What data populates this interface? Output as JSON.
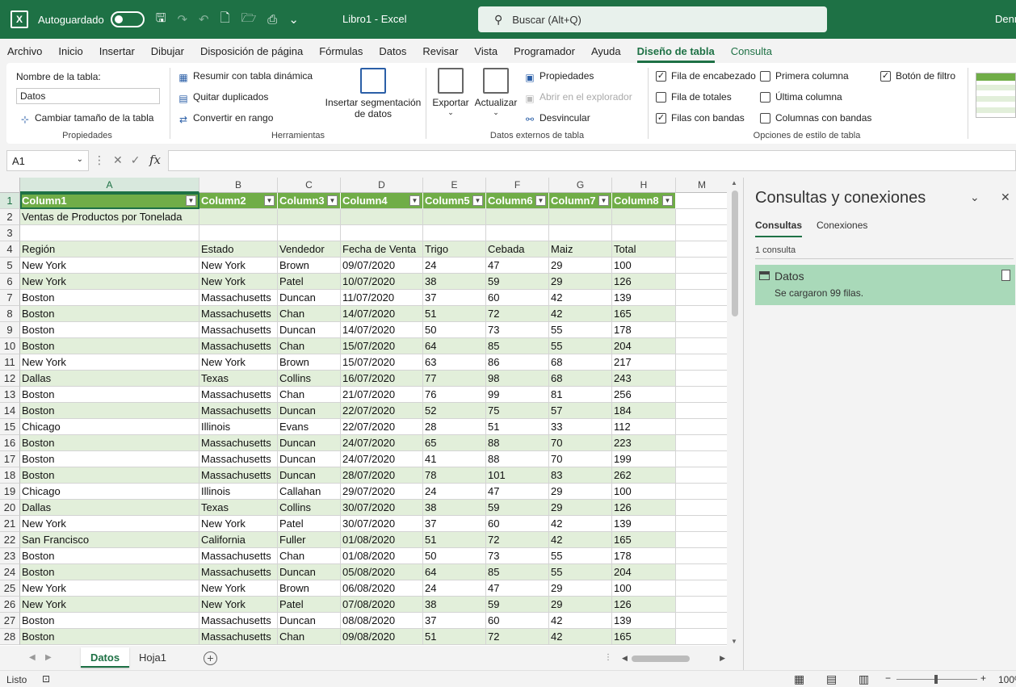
{
  "titlebar": {
    "autosave_label": "Autoguardado",
    "doc_title": "Libro1  -  Excel",
    "search_placeholder": "Buscar (Alt+Q)",
    "user": "Denn"
  },
  "menu": [
    "Archivo",
    "Inicio",
    "Insertar",
    "Dibujar",
    "Disposición de página",
    "Fórmulas",
    "Datos",
    "Revisar",
    "Vista",
    "Programador",
    "Ayuda",
    "Diseño de tabla",
    "Consulta"
  ],
  "ribbon": {
    "props": {
      "table_name_label": "Nombre de la tabla:",
      "table_name_value": "Datos",
      "resize": "Cambiar tamaño de la tabla",
      "group": "Propiedades"
    },
    "tools": {
      "pivot": "Resumir con tabla dinámica",
      "dedupe": "Quitar duplicados",
      "convert": "Convertir en rango",
      "slicer_line1": "Insertar segmentación",
      "slicer_line2": "de datos",
      "group": "Herramientas"
    },
    "external": {
      "export": "Exportar",
      "refresh": "Actualizar",
      "properties": "Propiedades",
      "open_browser": "Abrir en el explorador",
      "unlink": "Desvincular",
      "group": "Datos externos de tabla"
    },
    "style_options": {
      "header_row": "Fila de encabezado",
      "total_row": "Fila de totales",
      "banded_rows": "Filas con bandas",
      "first_col": "Primera columna",
      "last_col": "Última columna",
      "banded_cols": "Columnas con bandas",
      "filter_btn": "Botón de filtro",
      "group": "Opciones de estilo de tabla"
    }
  },
  "formula_bar": {
    "name_box": "A1",
    "fx": "fx"
  },
  "columns": [
    "A",
    "B",
    "C",
    "D",
    "E",
    "F",
    "G",
    "H",
    "M"
  ],
  "table_headers": [
    "Column1",
    "Column2",
    "Column3",
    "Column4",
    "Column5",
    "Column6",
    "Column7",
    "Column8"
  ],
  "rows": [
    {
      "n": "2",
      "c": [
        "Ventas de Productos por Tonelada",
        "",
        "",
        "",
        "",
        "",
        "",
        ""
      ]
    },
    {
      "n": "3",
      "c": [
        "",
        "",
        "",
        "",
        "",
        "",
        "",
        ""
      ]
    },
    {
      "n": "4",
      "c": [
        "Región",
        "Estado",
        "Vendedor",
        "Fecha de Venta",
        "Trigo",
        "Cebada",
        "Maiz",
        "Total"
      ]
    },
    {
      "n": "5",
      "c": [
        "New York",
        "New York",
        "Brown",
        "09/07/2020",
        "24",
        "47",
        "29",
        "100"
      ]
    },
    {
      "n": "6",
      "c": [
        "New York",
        "New York",
        "Patel",
        "10/07/2020",
        "38",
        "59",
        "29",
        "126"
      ]
    },
    {
      "n": "7",
      "c": [
        "Boston",
        "Massachusetts",
        "Duncan",
        "11/07/2020",
        "37",
        "60",
        "42",
        "139"
      ]
    },
    {
      "n": "8",
      "c": [
        "Boston",
        "Massachusetts",
        "Chan",
        "14/07/2020",
        "51",
        "72",
        "42",
        "165"
      ]
    },
    {
      "n": "9",
      "c": [
        "Boston",
        "Massachusetts",
        "Duncan",
        "14/07/2020",
        "50",
        "73",
        "55",
        "178"
      ]
    },
    {
      "n": "10",
      "c": [
        "Boston",
        "Massachusetts",
        "Chan",
        "15/07/2020",
        "64",
        "85",
        "55",
        "204"
      ]
    },
    {
      "n": "11",
      "c": [
        "New York",
        "New York",
        "Brown",
        "15/07/2020",
        "63",
        "86",
        "68",
        "217"
      ]
    },
    {
      "n": "12",
      "c": [
        "Dallas",
        "Texas",
        "Collins",
        "16/07/2020",
        "77",
        "98",
        "68",
        "243"
      ]
    },
    {
      "n": "13",
      "c": [
        "Boston",
        "Massachusetts",
        "Chan",
        "21/07/2020",
        "76",
        "99",
        "81",
        "256"
      ]
    },
    {
      "n": "14",
      "c": [
        "Boston",
        "Massachusetts",
        "Duncan",
        "22/07/2020",
        "52",
        "75",
        "57",
        "184"
      ]
    },
    {
      "n": "15",
      "c": [
        "Chicago",
        "Illinois",
        "Evans",
        "22/07/2020",
        "28",
        "51",
        "33",
        "112"
      ]
    },
    {
      "n": "16",
      "c": [
        "Boston",
        "Massachusetts",
        "Duncan",
        "24/07/2020",
        "65",
        "88",
        "70",
        "223"
      ]
    },
    {
      "n": "17",
      "c": [
        "Boston",
        "Massachusetts",
        "Duncan",
        "24/07/2020",
        "41",
        "88",
        "70",
        "199"
      ]
    },
    {
      "n": "18",
      "c": [
        "Boston",
        "Massachusetts",
        "Duncan",
        "28/07/2020",
        "78",
        "101",
        "83",
        "262"
      ]
    },
    {
      "n": "19",
      "c": [
        "Chicago",
        "Illinois",
        "Callahan",
        "29/07/2020",
        "24",
        "47",
        "29",
        "100"
      ]
    },
    {
      "n": "20",
      "c": [
        "Dallas",
        "Texas",
        "Collins",
        "30/07/2020",
        "38",
        "59",
        "29",
        "126"
      ]
    },
    {
      "n": "21",
      "c": [
        "New York",
        "New York",
        "Patel",
        "30/07/2020",
        "37",
        "60",
        "42",
        "139"
      ]
    },
    {
      "n": "22",
      "c": [
        "San Francisco",
        "California",
        "Fuller",
        "01/08/2020",
        "51",
        "72",
        "42",
        "165"
      ]
    },
    {
      "n": "23",
      "c": [
        "Boston",
        "Massachusetts",
        "Chan",
        "01/08/2020",
        "50",
        "73",
        "55",
        "178"
      ]
    },
    {
      "n": "24",
      "c": [
        "Boston",
        "Massachusetts",
        "Duncan",
        "05/08/2020",
        "64",
        "85",
        "55",
        "204"
      ]
    },
    {
      "n": "25",
      "c": [
        "New York",
        "New York",
        "Brown",
        "06/08/2020",
        "24",
        "47",
        "29",
        "100"
      ]
    },
    {
      "n": "26",
      "c": [
        "New York",
        "New York",
        "Patel",
        "07/08/2020",
        "38",
        "59",
        "29",
        "126"
      ]
    },
    {
      "n": "27",
      "c": [
        "Boston",
        "Massachusetts",
        "Duncan",
        "08/08/2020",
        "37",
        "60",
        "42",
        "139"
      ]
    },
    {
      "n": "28",
      "c": [
        "Boston",
        "Massachusetts",
        "Chan",
        "09/08/2020",
        "51",
        "72",
        "42",
        "165"
      ]
    }
  ],
  "sheets": [
    "Datos",
    "Hoja1"
  ],
  "status": {
    "text": "Listo",
    "zoom": "100%"
  },
  "queries_pane": {
    "title": "Consultas y conexiones",
    "tab_queries": "Consultas",
    "tab_connections": "Conexiones",
    "count": "1 consulta",
    "item_name": "Datos",
    "item_status": "Se cargaron 99 filas."
  },
  "colors": {
    "excel_green": "#1e7145",
    "table_header": "#70ad47",
    "band": "#e2efda",
    "query_item": "#a9d9b9"
  }
}
